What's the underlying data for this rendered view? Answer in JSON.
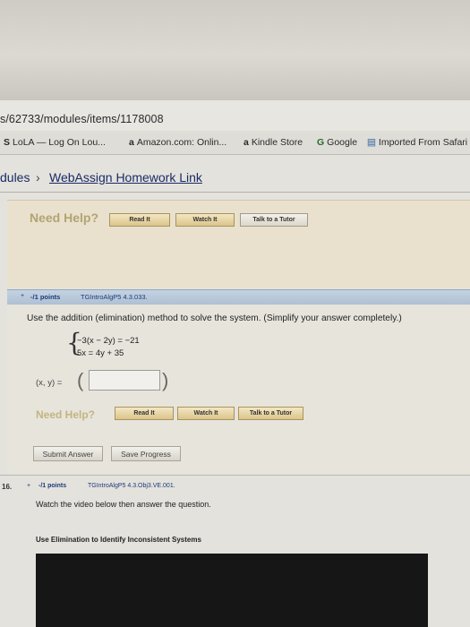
{
  "browser": {
    "url": "s/62733/modules/items/1178008",
    "bookmarks": [
      {
        "icon": "S",
        "label": "LoLA — Log On Lou..."
      },
      {
        "icon": "a",
        "label": "Amazon.com: Onlin..."
      },
      {
        "icon": "a",
        "label": "Kindle Store"
      },
      {
        "icon": "G",
        "label": "Google"
      },
      {
        "icon": "▤",
        "label": "Imported From Safari"
      }
    ]
  },
  "breadcrumb": {
    "parent": "dules",
    "separator": "›",
    "current": "WebAssign Homework Link"
  },
  "help_panel": {
    "need_help": "Need Help?",
    "read_it": "Read It",
    "watch_it": "Watch It",
    "talk_to_tutor": "Talk to a Tutor"
  },
  "question15": {
    "dot": "+",
    "points": "-/1 points",
    "code": "TGIntroAlgP5 4.3.033.",
    "instruction": "Use the addition (elimination) method to solve the system. (Simplify your answer completely.)",
    "equation1": "−3(x − 2y) = −21",
    "equation2": "5x = 4y + 35",
    "answer_label": "(x, y) =",
    "answer_value": "",
    "need_help": "Need Help?",
    "read_it": "Read It",
    "watch_it": "Watch It",
    "talk_to_tutor": "Talk to a Tutor",
    "submit": "Submit Answer",
    "save": "Save Progress"
  },
  "question16": {
    "number": "16.",
    "dot": "+",
    "points": "-/1 points",
    "code": "TGIntroAlgP5 4.3.Obj3.VE.001.",
    "instruction": "Watch the video below then answer the question.",
    "video_title": "Use Elimination to Identify Inconsistent Systems"
  }
}
